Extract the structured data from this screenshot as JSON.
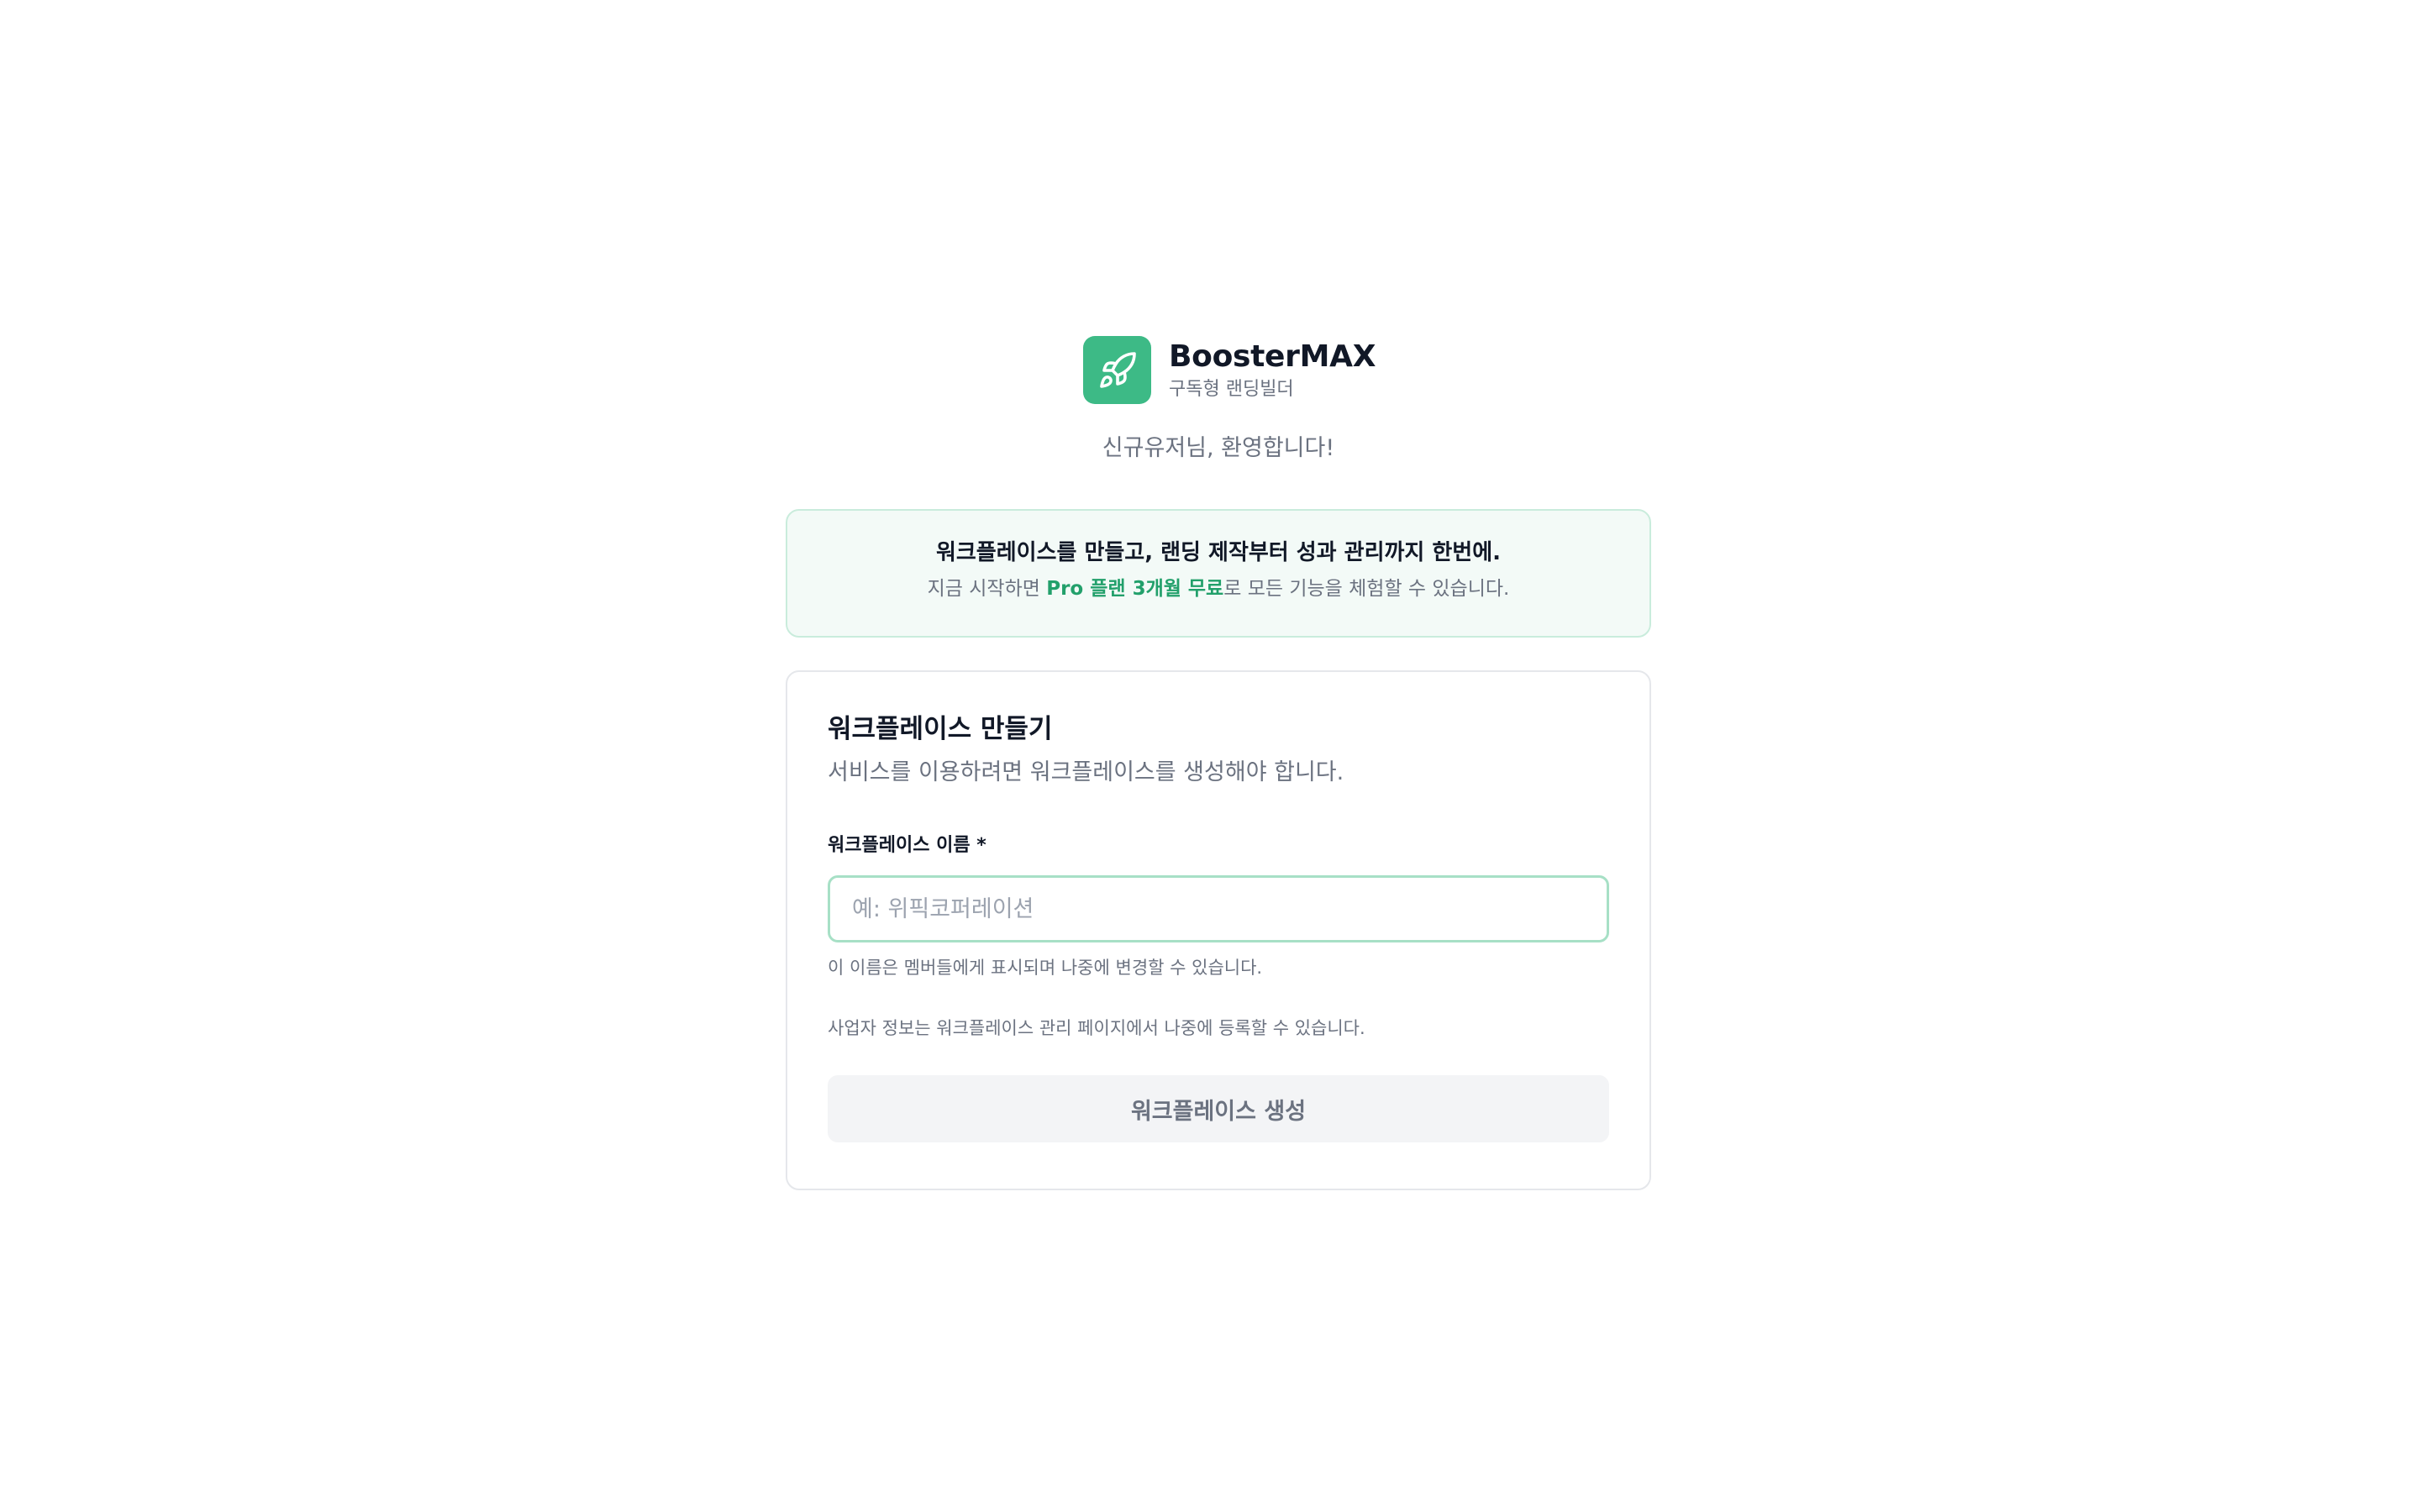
{
  "brand": {
    "name": "BoosterMAX",
    "tagline": "구독형 랜딩빌더",
    "logo_icon": "rocket-icon",
    "accent_color": "#3dba86"
  },
  "welcome_text": "신규유저님, 환영합니다!",
  "promo": {
    "title": "워크플레이스를 만들고, 랜딩 제작부터 성과 관리까지 한번에.",
    "sub_before": "지금 시작하면 ",
    "sub_highlight": "Pro 플랜 3개월 무료",
    "sub_after": "로 모든 기능을 체험할 수 있습니다.",
    "highlight_color": "#22a06b"
  },
  "form": {
    "title": "워크플레이스 만들기",
    "description": "서비스를 이용하려면 워크플레이스를 생성해야 합니다.",
    "name_label": "워크플레이스 이름 *",
    "name_placeholder": "예: 위픽코퍼레이션",
    "name_value": "",
    "name_help": "이 이름은 멤버들에게 표시되며 나중에 변경할 수 있습니다.",
    "business_note": "사업자 정보는 워크플레이스 관리 페이지에서 나중에 등록할 수 있습니다.",
    "submit_label": "워크플레이스 생성"
  }
}
